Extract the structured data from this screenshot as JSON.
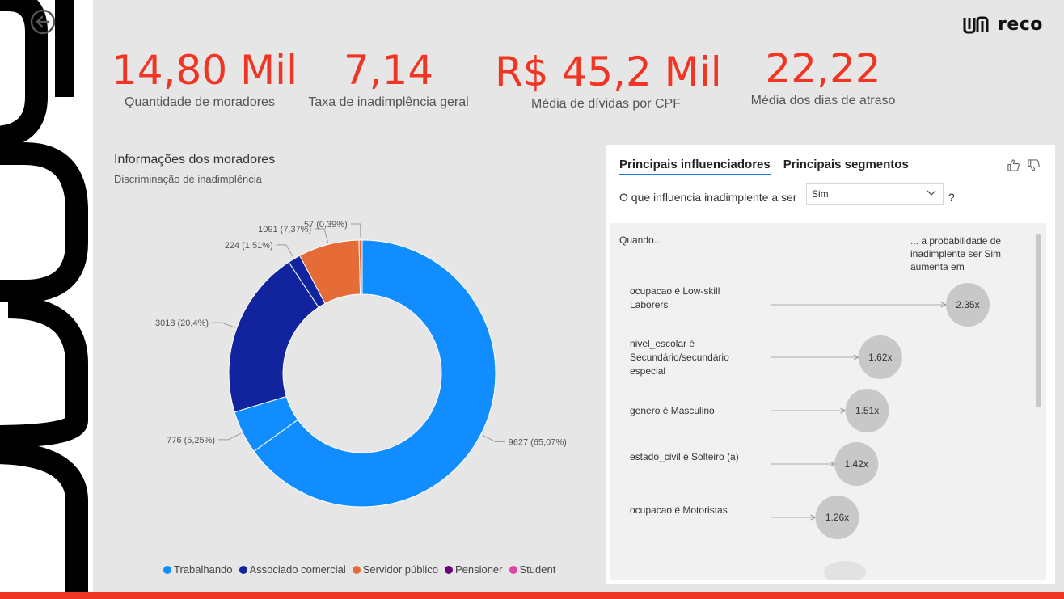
{
  "back_icon": "back-arrow-icon",
  "logo": {
    "text": "reco"
  },
  "kpis": [
    {
      "value": "14,80 Mil",
      "label": "Quantidade de moradores"
    },
    {
      "value": "7,14",
      "label": "Taxa de inadimplência geral"
    },
    {
      "value": "R$ 45,2 Mil",
      "label": "Média de dívidas por CPF"
    },
    {
      "value": "22,22",
      "label": "Média dos dias de atraso"
    }
  ],
  "chart_section": {
    "title": "Informações dos moradores",
    "subtitle": "Discriminação de inadimplência"
  },
  "chart_data": {
    "type": "pie",
    "donut": true,
    "categories": [
      "Trabalhando",
      "Associado comercial",
      "Servidor público",
      "Pensioner",
      "Student"
    ],
    "values": [
      9627,
      776,
      3018,
      224,
      1091,
      57
    ],
    "slices": [
      {
        "category": "Trabalhando",
        "value": 9627,
        "label": "9627 (65,07%)",
        "color": "#118dff"
      },
      {
        "category": "Trabalhando",
        "value": 776,
        "label": "776 (5,25%)",
        "color": "#118dff"
      },
      {
        "category": "Associado comercial",
        "value": 3018,
        "label": "3018 (20,4%)",
        "color": "#12239e"
      },
      {
        "category": "Associado comercial",
        "value": 224,
        "label": "224 (1,51%)",
        "color": "#12239e"
      },
      {
        "category": "Servidor público",
        "value": 1091,
        "label": "1091 (7,37%)",
        "color": "#e66c37"
      },
      {
        "category": "Servidor público",
        "value": 57,
        "label": "57 (0,39%)",
        "color": "#e66c37"
      }
    ],
    "legend": [
      {
        "name": "Trabalhando",
        "color": "#118dff"
      },
      {
        "name": "Associado comercial",
        "color": "#12239e"
      },
      {
        "name": "Servidor público",
        "color": "#e66c37"
      },
      {
        "name": "Pensioner",
        "color": "#6b007b"
      },
      {
        "name": "Student",
        "color": "#e044a7"
      }
    ],
    "legend_position": "bottom"
  },
  "influencers": {
    "tabs": [
      "Principais influenciadores",
      "Principais segmentos"
    ],
    "active_tab": 0,
    "question": "O que influencia inadimplente a ser",
    "select_value": "Sim",
    "question_mark": "?",
    "when_label": "Quando...",
    "prob_label": "... a probabilidade de inadimplente ser Sim aumenta em",
    "items": [
      {
        "label": "ocupacao é Low-skill Laborers",
        "value": "2.35x",
        "factor": 2.35
      },
      {
        "label": "nivel_escolar é Secundário/secundário especial",
        "value": "1.62x",
        "factor": 1.62
      },
      {
        "label": "genero é Masculino",
        "value": "1.51x",
        "factor": 1.51
      },
      {
        "label": "estado_civil é Solteiro (a)",
        "value": "1.42x",
        "factor": 1.42
      },
      {
        "label": "ocupacao é Motoristas",
        "value": "1.26x",
        "factor": 1.26
      }
    ]
  },
  "colors": {
    "accent": "#ef3524",
    "tab_underline": "#1f7ad6"
  }
}
